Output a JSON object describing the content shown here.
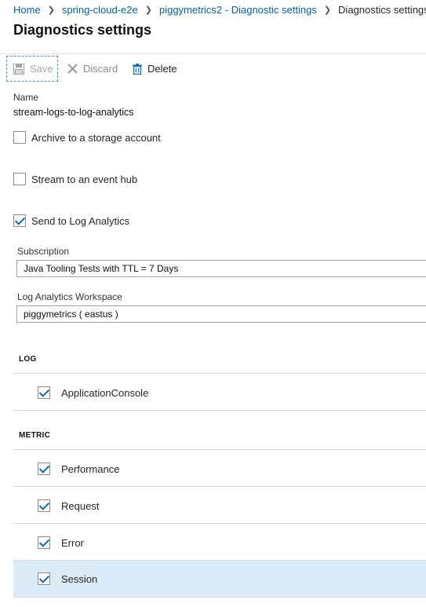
{
  "breadcrumb": {
    "items": [
      "Home",
      "spring-cloud-e2e",
      "piggymetrics2 - Diagnostic settings"
    ],
    "current": "Diagnostics settings"
  },
  "page": {
    "title": "Diagnostics settings"
  },
  "toolbar": {
    "save": "Save",
    "discard": "Discard",
    "delete": "Delete"
  },
  "form": {
    "name_label": "Name",
    "name_value": "stream-logs-to-log-analytics",
    "archive_label": "Archive to a storage account",
    "archive_checked": false,
    "eventhub_label": "Stream to an event hub",
    "eventhub_checked": false,
    "loganalytics_label": "Send to Log Analytics",
    "loganalytics_checked": true,
    "subscription_label": "Subscription",
    "subscription_value": "Java Tooling Tests with TTL = 7 Days",
    "workspace_label": "Log Analytics Workspace",
    "workspace_value": "piggymetrics ( eastus )"
  },
  "log": {
    "heading": "LOG",
    "items": [
      {
        "label": "ApplicationConsole",
        "checked": true
      }
    ]
  },
  "metric": {
    "heading": "METRIC",
    "items": [
      {
        "label": "Performance",
        "checked": true
      },
      {
        "label": "Request",
        "checked": true
      },
      {
        "label": "Error",
        "checked": true
      },
      {
        "label": "Session",
        "checked": true
      }
    ]
  },
  "colors": {
    "link": "#0063b1",
    "check": "#0f6cbd",
    "highlight": "#dcebf8"
  }
}
